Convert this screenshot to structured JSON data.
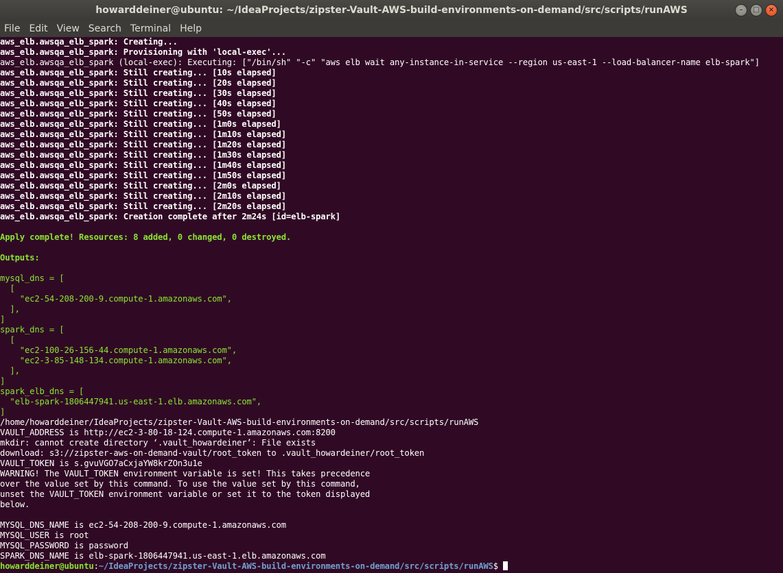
{
  "window": {
    "title": "howarddeiner@ubuntu: ~/IdeaProjects/zipster-Vault-AWS-build-environments-on-demand/src/scripts/runAWS"
  },
  "controls": {
    "minimize": "–",
    "maximize": "□",
    "close": "×"
  },
  "menu": [
    "File",
    "Edit",
    "View",
    "Search",
    "Terminal",
    "Help"
  ],
  "colors": {
    "background": "#300a24",
    "green": "#8ae234",
    "blue": "#729fcf",
    "text": "#ffffff"
  },
  "lines": [
    {
      "t": "aws_elb.awsqa_elb_spark: Creating...",
      "s": "b"
    },
    {
      "t": "aws_elb.awsqa_elb_spark: Provisioning with 'local-exec'...",
      "s": "b"
    },
    {
      "t": "aws_elb.awsqa_elb_spark (local-exec): Executing: [\"/bin/sh\" \"-c\" \"aws elb wait any-instance-in-service --region us-east-1 --load-balancer-name elb-spark\"]",
      "s": ""
    },
    {
      "t": "aws_elb.awsqa_elb_spark: Still creating... [10s elapsed]",
      "s": "b"
    },
    {
      "t": "aws_elb.awsqa_elb_spark: Still creating... [20s elapsed]",
      "s": "b"
    },
    {
      "t": "aws_elb.awsqa_elb_spark: Still creating... [30s elapsed]",
      "s": "b"
    },
    {
      "t": "aws_elb.awsqa_elb_spark: Still creating... [40s elapsed]",
      "s": "b"
    },
    {
      "t": "aws_elb.awsqa_elb_spark: Still creating... [50s elapsed]",
      "s": "b"
    },
    {
      "t": "aws_elb.awsqa_elb_spark: Still creating... [1m0s elapsed]",
      "s": "b"
    },
    {
      "t": "aws_elb.awsqa_elb_spark: Still creating... [1m10s elapsed]",
      "s": "b"
    },
    {
      "t": "aws_elb.awsqa_elb_spark: Still creating... [1m20s elapsed]",
      "s": "b"
    },
    {
      "t": "aws_elb.awsqa_elb_spark: Still creating... [1m30s elapsed]",
      "s": "b"
    },
    {
      "t": "aws_elb.awsqa_elb_spark: Still creating... [1m40s elapsed]",
      "s": "b"
    },
    {
      "t": "aws_elb.awsqa_elb_spark: Still creating... [1m50s elapsed]",
      "s": "b"
    },
    {
      "t": "aws_elb.awsqa_elb_spark: Still creating... [2m0s elapsed]",
      "s": "b"
    },
    {
      "t": "aws_elb.awsqa_elb_spark: Still creating... [2m10s elapsed]",
      "s": "b"
    },
    {
      "t": "aws_elb.awsqa_elb_spark: Still creating... [2m20s elapsed]",
      "s": "b"
    },
    {
      "t": "aws_elb.awsqa_elb_spark: Creation complete after 2m24s [id=elb-spark]",
      "s": "b"
    },
    {
      "t": "",
      "s": ""
    },
    {
      "t": "Apply complete! Resources: 8 added, 0 changed, 0 destroyed.",
      "s": "g"
    },
    {
      "t": "",
      "s": ""
    },
    {
      "t": "Outputs:",
      "s": "g"
    },
    {
      "t": "",
      "s": ""
    },
    {
      "t": "mysql_dns = [",
      "s": "ng"
    },
    {
      "t": "  [",
      "s": "ng"
    },
    {
      "t": "    \"ec2-54-208-200-9.compute-1.amazonaws.com\",",
      "s": "ng"
    },
    {
      "t": "  ],",
      "s": "ng"
    },
    {
      "t": "]",
      "s": "ng"
    },
    {
      "t": "spark_dns = [",
      "s": "ng"
    },
    {
      "t": "  [",
      "s": "ng"
    },
    {
      "t": "    \"ec2-100-26-156-44.compute-1.amazonaws.com\",",
      "s": "ng"
    },
    {
      "t": "    \"ec2-3-85-148-134.compute-1.amazonaws.com\",",
      "s": "ng"
    },
    {
      "t": "  ],",
      "s": "ng"
    },
    {
      "t": "]",
      "s": "ng"
    },
    {
      "t": "spark_elb_dns = [",
      "s": "ng"
    },
    {
      "t": "  \"elb-spark-1806447941.us-east-1.elb.amazonaws.com\",",
      "s": "ng"
    },
    {
      "t": "]",
      "s": "ng"
    },
    {
      "t": "/home/howarddeiner/IdeaProjects/zipster-Vault-AWS-build-environments-on-demand/src/scripts/runAWS",
      "s": ""
    },
    {
      "t": "VAULT_ADDRESS is http://ec2-3-80-18-124.compute-1.amazonaws.com:8200",
      "s": ""
    },
    {
      "t": "mkdir: cannot create directory ‘.vault_howardeiner’: File exists",
      "s": ""
    },
    {
      "t": "download: s3://zipster-aws-on-demand-vault/root_token to .vault_howardeiner/root_token",
      "s": ""
    },
    {
      "t": "VAULT_TOKEN is s.gvuVGO7aCxjaYW8krZOn3u1e",
      "s": ""
    },
    {
      "t": "WARNING! The VAULT_TOKEN environment variable is set! This takes precedence",
      "s": ""
    },
    {
      "t": "over the value set by this command. To use the value set by this command,",
      "s": ""
    },
    {
      "t": "unset the VAULT_TOKEN environment variable or set it to the token displayed",
      "s": ""
    },
    {
      "t": "below.",
      "s": ""
    },
    {
      "t": "",
      "s": ""
    },
    {
      "t": "MYSQL_DNS_NAME is ec2-54-208-200-9.compute-1.amazonaws.com",
      "s": ""
    },
    {
      "t": "MYSQL_USER is root",
      "s": ""
    },
    {
      "t": "MYSQL_PASSWORD is password",
      "s": ""
    },
    {
      "t": "SPARK_DNS_NAME is elb-spark-1806447941.us-east-1.elb.amazonaws.com",
      "s": ""
    }
  ],
  "prompt": {
    "user_host": "howarddeiner@ubuntu",
    "separator": ":",
    "path": "~/IdeaProjects/zipster-Vault-AWS-build-environments-on-demand/src/scripts/runAWS",
    "symbol": "$ "
  }
}
